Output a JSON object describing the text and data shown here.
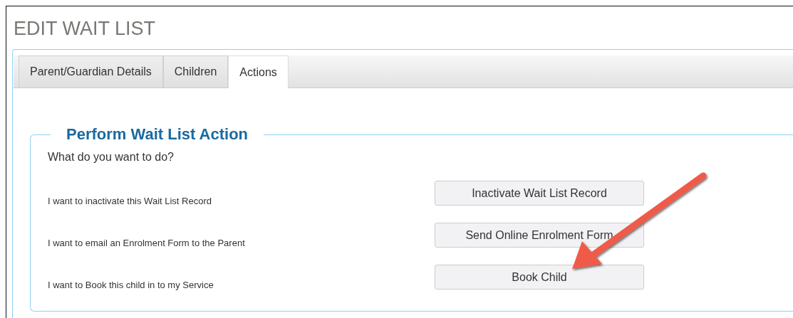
{
  "page": {
    "title": "EDIT WAIT LIST"
  },
  "tabs": [
    {
      "label": "Parent/Guardian Details",
      "selected": false
    },
    {
      "label": "Children",
      "selected": false
    },
    {
      "label": "Actions",
      "selected": true
    }
  ],
  "action_panel": {
    "legend": "Perform Wait List Action",
    "question": "What do you want to do?",
    "actions": [
      {
        "description": "I want to inactivate this Wait List Record",
        "button": "Inactivate Wait List Record"
      },
      {
        "description": "I want to email an Enrolment Form to the Parent",
        "button": "Send Online Enrolment Form"
      },
      {
        "description": "I want to Book this child in to my Service",
        "button": "Book Child"
      }
    ]
  }
}
